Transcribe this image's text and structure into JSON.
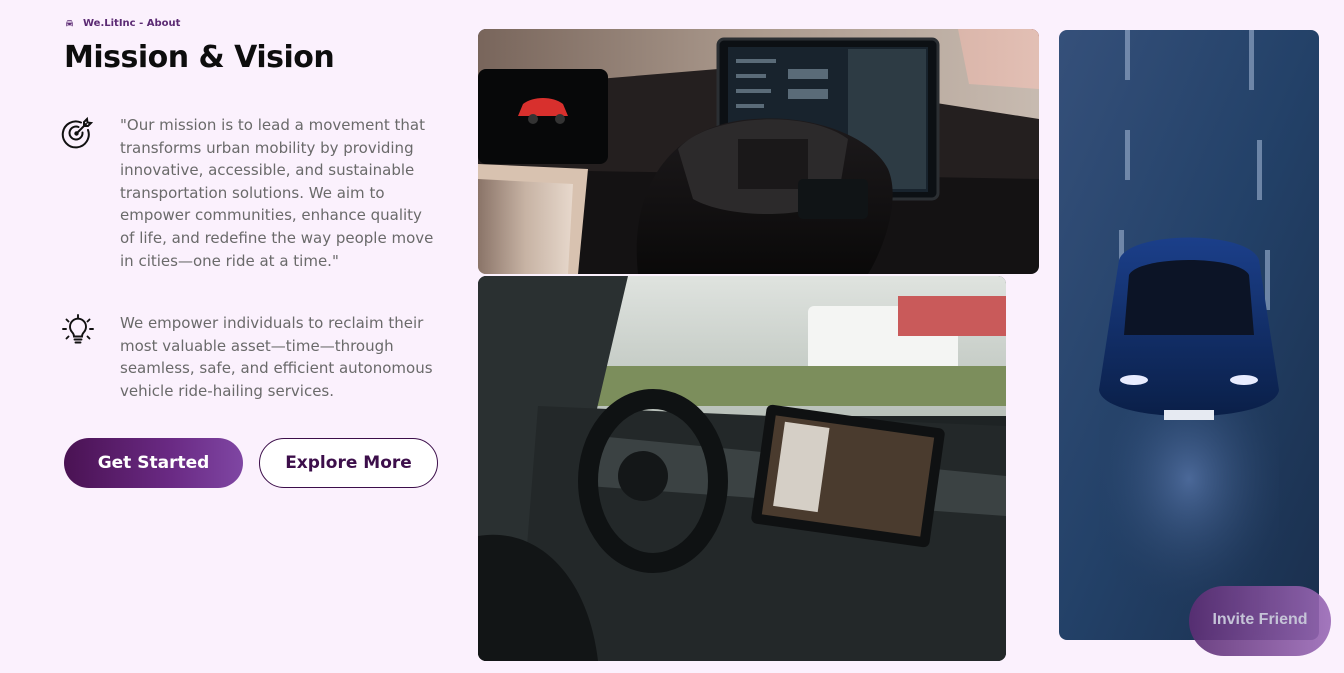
{
  "breadcrumb": {
    "icon": "car-icon",
    "text": "We.LitInc - About"
  },
  "title": "Mission & Vision",
  "mission": {
    "icon": "target-icon",
    "text": "\"Our mission is to lead a movement that transforms urban mobility by providing innovative, accessible, and sustainable transportation solutions. We aim to empower communities, enhance quality of life, and redefine the way people move in cities—one ride at a time.\""
  },
  "vision": {
    "icon": "lightbulb-icon",
    "text": "We empower individuals to reclaim their most valuable asset—time—through seamless, safe, and efficient autonomous vehicle ride-hailing services."
  },
  "buttons": {
    "primary": "Get Started",
    "secondary": "Explore More"
  },
  "invite": {
    "label": "Invite Friend"
  },
  "colors": {
    "background": "#fbf1fd",
    "accent": "#4a1253",
    "accent_light": "#7f46a3",
    "text_muted": "#6a6a6a"
  }
}
